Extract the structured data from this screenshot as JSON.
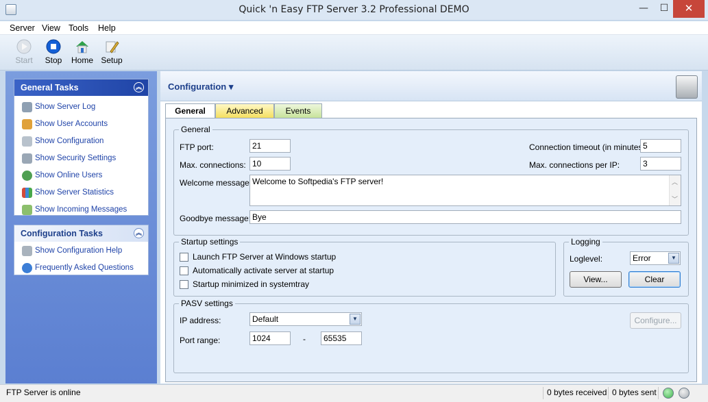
{
  "window": {
    "title": "Quick 'n Easy FTP Server 3.2 Professional DEMO",
    "min": "—",
    "max": "☐",
    "close": "✕"
  },
  "menu": [
    "Server",
    "View",
    "Tools",
    "Help"
  ],
  "toolbar": {
    "start": "Start",
    "stop": "Stop",
    "home": "Home",
    "setup": "Setup"
  },
  "general_tasks": {
    "title": "General Tasks",
    "items": [
      "Show Server Log",
      "Show User Accounts",
      "Show Configuration",
      "Show Security Settings",
      "Show Online Users",
      "Show Server Statistics",
      "Show Incoming Messages"
    ]
  },
  "config_tasks": {
    "title": "Configuration Tasks",
    "items": [
      "Show Configuration Help",
      "Frequently Asked Questions"
    ]
  },
  "main": {
    "title": "Configuration ▾",
    "tabs": [
      "General",
      "Advanced",
      "Events"
    ]
  },
  "general": {
    "legend": "General",
    "ftp_port_label": "FTP port:",
    "ftp_port": "21",
    "max_conn_label": "Max. connections:",
    "max_conn": "10",
    "timeout_label": "Connection timeout (in minutes):",
    "timeout": "5",
    "max_per_ip_label": "Max. connections per IP:",
    "max_per_ip": "3",
    "welcome_label": "Welcome message:",
    "welcome": "Welcome to Softpedia's FTP server!",
    "goodbye_label": "Goodbye message:",
    "goodbye": "Bye"
  },
  "startup": {
    "legend": "Startup settings",
    "options": [
      "Launch FTP Server at Windows startup",
      "Automatically activate server at startup",
      "Startup minimized in systemtray"
    ]
  },
  "logging": {
    "legend": "Logging",
    "level_label": "Loglevel:",
    "level": "Error",
    "view": "View...",
    "clear": "Clear"
  },
  "pasv": {
    "legend": "PASV settings",
    "ip_label": "IP address:",
    "ip": "Default",
    "configure": "Configure...",
    "port_range_label": "Port range:",
    "port_from": "1024",
    "dash": "-",
    "port_to": "65535"
  },
  "status": {
    "message": "FTP Server is online",
    "received": "0 bytes received",
    "sent": "0 bytes sent"
  },
  "colors": {
    "accent": "#1f43a8",
    "online_led": "#3fb34f"
  }
}
